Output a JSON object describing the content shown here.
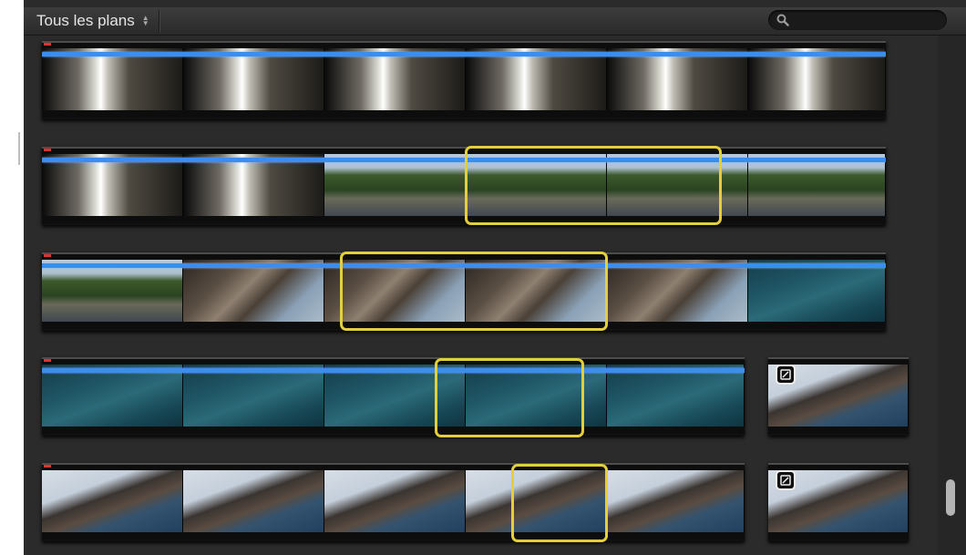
{
  "toolbar": {
    "filter_label": "Tous les plans",
    "filter_arrows_icon": "stepper-arrows-icon",
    "search_icon": "search-icon",
    "search_value": ""
  },
  "colors": {
    "selection": "#e3cf3b",
    "keyword_bar": "#3b8df0",
    "background": "#2b2b2b"
  }
}
